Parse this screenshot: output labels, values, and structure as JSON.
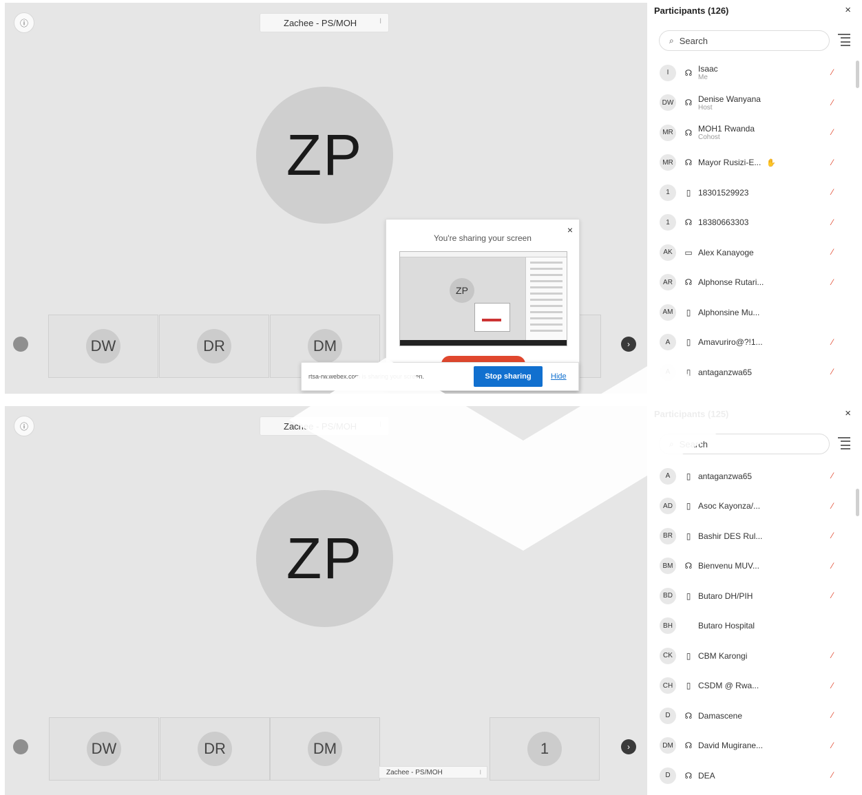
{
  "panels": [
    {
      "header_name": "Zachee - PS/MOH",
      "big_avatar": "ZP",
      "tiles": [
        "DW",
        "DR",
        "DM"
      ],
      "participants_title": "Participants (126)",
      "search_placeholder": "Search",
      "participants": [
        {
          "initials": "I",
          "device": "headset",
          "name": "Isaac",
          "role": "Me",
          "badge": true,
          "muted": true
        },
        {
          "initials": "DW",
          "device": "headset",
          "name": "Denise Wanyana",
          "role": "Host",
          "muted": true
        },
        {
          "initials": "MR",
          "device": "headset",
          "name": "MOH1 Rwanda",
          "role": "Cohost",
          "muted": true
        },
        {
          "initials": "MR",
          "device": "headset",
          "name": "Mayor Rusizi-E...",
          "extra": "hand",
          "muted": true
        },
        {
          "initials": "1",
          "device": "phone",
          "name": "18301529923",
          "muted": true
        },
        {
          "initials": "1",
          "device": "headset",
          "name": "18380663303",
          "muted": true
        },
        {
          "initials": "AK",
          "device": "desktop",
          "name": "Alex Kanayoge",
          "muted": true
        },
        {
          "initials": "AR",
          "device": "headset",
          "name": "Alphonse Rutari...",
          "muted": true
        },
        {
          "initials": "AM",
          "device": "phone",
          "name": "Alphonsine Mu...",
          "muted": false
        },
        {
          "initials": "A",
          "device": "phone",
          "name": "Amavuriro@?!1...",
          "muted": true
        },
        {
          "initials": "A",
          "device": "phone",
          "name": "antaganzwa65",
          "muted": true
        }
      ],
      "share": {
        "title": "You're sharing your screen",
        "thumb_initials": "ZP",
        "message": "rtsa-rw.webex.com is sharing your screen.",
        "stop_label": "Stop sharing",
        "hide_label": "Hide"
      }
    },
    {
      "header_name": "Zachee - PS/MOH",
      "big_avatar": "ZP",
      "tiles": [
        "DW",
        "DR",
        "DM",
        "1"
      ],
      "tile_caption": "Zachee - PS/MOH",
      "participants_title": "Participants (125)",
      "search_placeholder": "Search",
      "participants": [
        {
          "initials": "A",
          "device": "phone",
          "name": "antaganzwa65",
          "muted": true
        },
        {
          "initials": "AD",
          "device": "phone",
          "name": "Asoc Kayonza/...",
          "muted": true
        },
        {
          "initials": "BR",
          "device": "phone",
          "name": "Bashir DES Rul...",
          "muted": true
        },
        {
          "initials": "BM",
          "device": "headset",
          "name": "Bienvenu MUV...",
          "muted": true
        },
        {
          "initials": "BD",
          "device": "phone",
          "name": "Butaro DH/PIH",
          "muted": true
        },
        {
          "initials": "BH",
          "device": "",
          "name": "Butaro Hospital",
          "muted": false
        },
        {
          "initials": "CK",
          "device": "phone",
          "name": "CBM Karongi",
          "muted": true
        },
        {
          "initials": "CH",
          "device": "phone",
          "name": "CSDM @ Rwa...",
          "muted": true
        },
        {
          "initials": "D",
          "device": "headset",
          "name": "Damascene",
          "muted": true
        },
        {
          "initials": "DM",
          "device": "headset",
          "name": "David Mugirane...",
          "muted": true
        },
        {
          "initials": "D",
          "device": "headset",
          "name": "DEA",
          "muted": true
        }
      ]
    }
  ],
  "icons": {
    "info": "info-icon",
    "close": "close-icon",
    "search": "search-icon",
    "sort": "sort-icon",
    "headset": "headset-icon",
    "phone": "phone-icon",
    "desktop": "desktop-icon",
    "muted_mic": "muted-mic-icon"
  },
  "colors": {
    "accent": "#1170cf",
    "muted": "#e0472e",
    "stage": "#e6e6e6"
  }
}
